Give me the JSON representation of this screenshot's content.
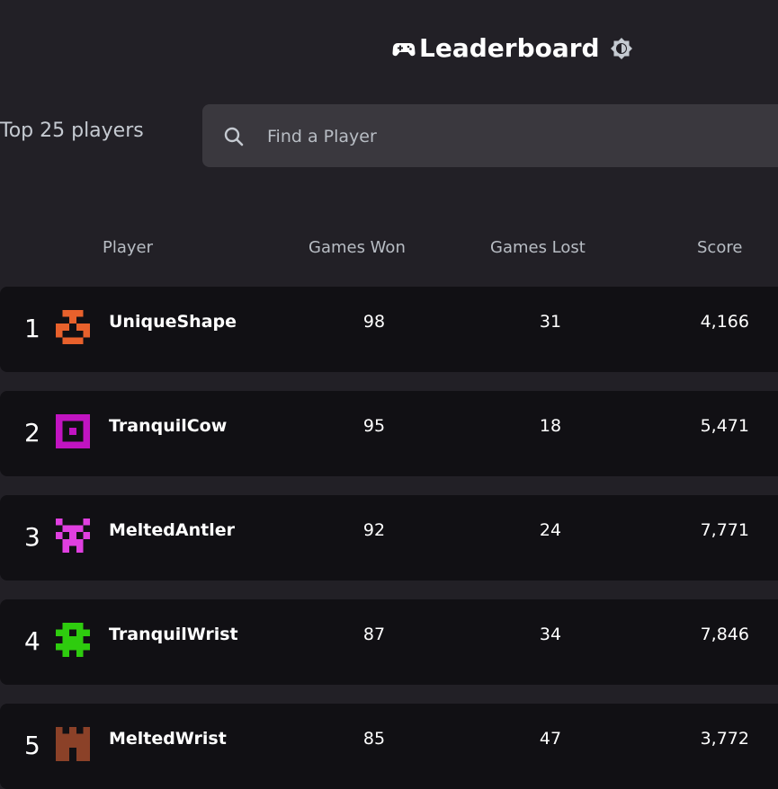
{
  "header": {
    "title": "Leaderboard",
    "gamepad_icon": "gamepad-icon",
    "theme_icon": "theme-toggle-icon"
  },
  "subtitle": "Top 25 players",
  "search": {
    "placeholder": "Find a Player",
    "value": "",
    "icon": "search-icon"
  },
  "columns": {
    "player": "Player",
    "won": "Games Won",
    "lost": "Games Lost",
    "score": "Score"
  },
  "rows": [
    {
      "rank": "1",
      "name": "UniqueShape",
      "won": "98",
      "lost": "31",
      "score": "4,166",
      "avatar_color": "#e8612c"
    },
    {
      "rank": "2",
      "name": "TranquilCow",
      "won": "95",
      "lost": "18",
      "score": "5,471",
      "avatar_color": "#c114c1"
    },
    {
      "rank": "3",
      "name": "MeltedAntler",
      "won": "92",
      "lost": "24",
      "score": "7,771",
      "avatar_color": "#e03fe0"
    },
    {
      "rank": "4",
      "name": "TranquilWrist",
      "won": "87",
      "lost": "34",
      "score": "7,846",
      "avatar_color": "#2ecc0e"
    },
    {
      "rank": "5",
      "name": "MeltedWrist",
      "won": "85",
      "lost": "47",
      "score": "3,772",
      "avatar_color": "#8b4128"
    }
  ]
}
